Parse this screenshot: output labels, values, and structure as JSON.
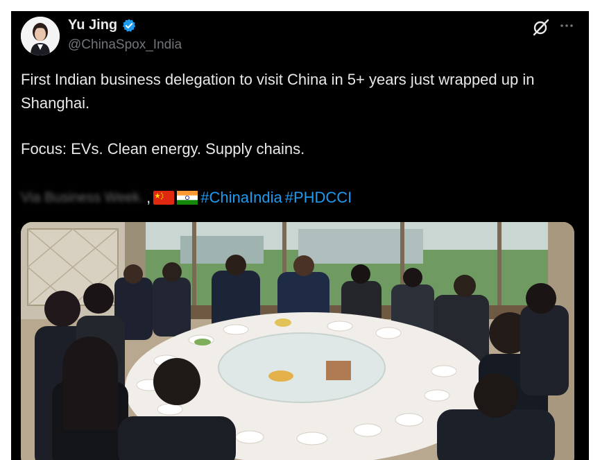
{
  "post": {
    "author": {
      "display_name": "Yu Jing",
      "handle": "@ChinaSpox_India",
      "verified_icon": "verified-badge-icon",
      "avatar_icon": "profile-avatar"
    },
    "actions": {
      "grok_icon": "grok-icon",
      "more_icon": "more-options-icon"
    },
    "text": {
      "paragraph1": "First Indian business delegation to visit China in 5+ years just wrapped up in Shanghai.",
      "paragraph2": "Focus: EVs. Clean energy. Supply chains.",
      "blurred_text": "Via Business Week.",
      "flags": [
        "china-flag",
        "india-flag"
      ],
      "hashtags": [
        "#ChinaIndia",
        "#PHDCCI"
      ]
    },
    "media": {
      "type": "photo"
    },
    "colors": {
      "background": "#000000",
      "text": "#e7e9ea",
      "secondary_text": "#71767b",
      "link": "#1d9bf0",
      "verified": "#1d9bf0"
    }
  }
}
